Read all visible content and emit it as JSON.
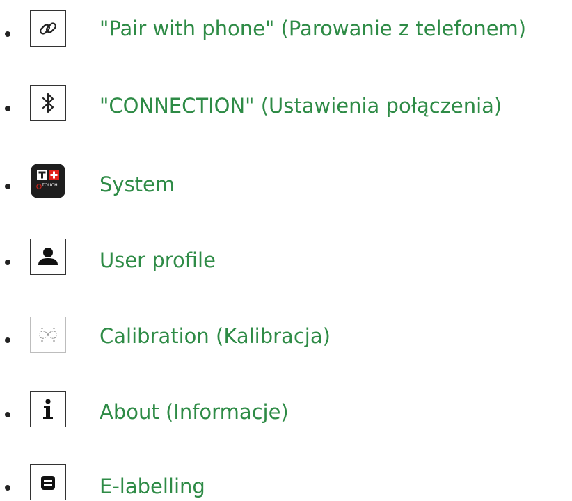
{
  "menu": {
    "items": [
      {
        "id": "pair-with-phone",
        "icon": "link-icon",
        "label": "\"Pair with phone\" (Parowanie z telefonem)"
      },
      {
        "id": "connection",
        "icon": "bluetooth-icon",
        "label": "\"CONNECTION\" (Ustawienia połączenia)"
      },
      {
        "id": "system",
        "icon": "tissot-t-touch-app-icon",
        "label": "System",
        "app_icon_text": "TOUCH"
      },
      {
        "id": "user-profile",
        "icon": "user-icon",
        "label": "User profile"
      },
      {
        "id": "calibration",
        "icon": "infinity-calibration-icon",
        "label": "Calibration (Kalibracja)"
      },
      {
        "id": "about",
        "icon": "info-icon",
        "label": "About (Informacje)"
      },
      {
        "id": "e-labelling",
        "icon": "document-lines-icon",
        "label": "E-labelling"
      }
    ]
  },
  "colors": {
    "link_text": "#2e8b46",
    "icon_border": "#333333",
    "app_icon_bg": "#1e1e1e",
    "app_red": "#e2231a"
  }
}
